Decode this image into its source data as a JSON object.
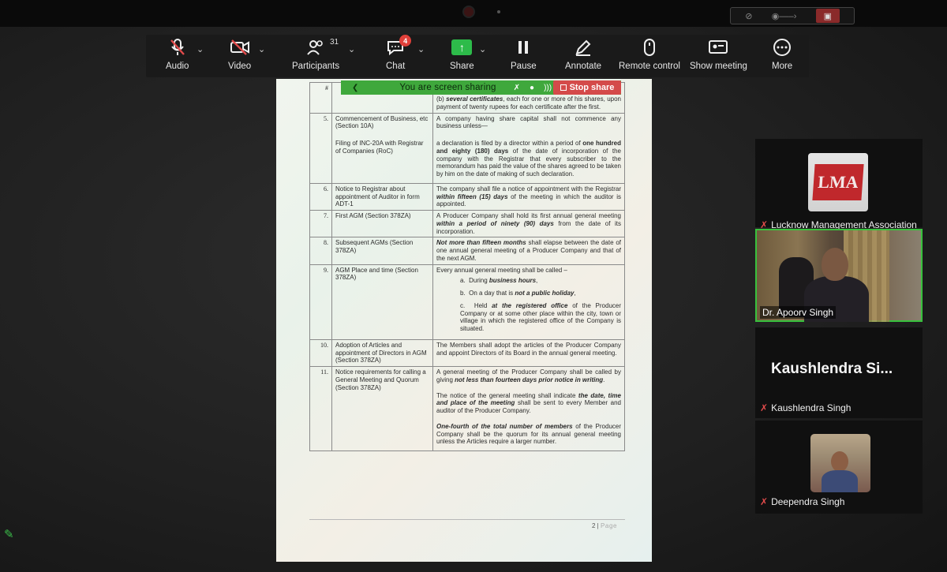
{
  "toolbar": {
    "audio": "Audio",
    "video": "Video",
    "participants": "Participants",
    "participants_count": "31",
    "chat": "Chat",
    "chat_badge": "4",
    "share": "Share",
    "pause": "Pause",
    "annotate": "Annotate",
    "remote_control": "Remote control",
    "show_meeting": "Show meeting",
    "more": "More"
  },
  "sharing_banner": {
    "text": "You are screen sharing",
    "stop_label": "Stop share"
  },
  "document": {
    "header_mark": "#",
    "row0_rule": "several certificates",
    "row0_text_a": "(b) ",
    "row0_text_b": ", each for one or more of his shares, upon payment of twenty rupees for each certificate after the first.",
    "rows": [
      {
        "num": "5.",
        "topic": "Commencement of Business, etc (Section 10A)",
        "topic2": "Filing of INC-20A with Registrar of Companies (RoC)",
        "rule1": "A company having share capital shall not commence any business unless—",
        "rule2a": "a declaration is filed by a director within a period of ",
        "rule2b": "one hundred and eighty (180) days",
        "rule2c": " of the date of incorporation of the company with the Registrar that every subscriber to the memorandum has paid the value of the shares agreed to be taken by him on the date of making of such declaration."
      },
      {
        "num": "6.",
        "topic": "Notice to Registrar about appointment of Auditor in form ADT-1",
        "rule_a": "The company shall file a notice of appointment with the Registrar ",
        "rule_b": "within fifteen (15) days",
        "rule_c": " of the meeting in which the auditor is appointed."
      },
      {
        "num": "7.",
        "topic": "First AGM (Section 378ZA)",
        "rule_a": "A Producer Company shall hold its first annual general meeting ",
        "rule_b": "within a period of ninety (90) days",
        "rule_c": " from the date of its incorporation."
      },
      {
        "num": "8.",
        "topic": "Subsequent AGMs (Section 378ZA)",
        "rule_b": "Not more than fifteen months",
        "rule_c": " shall elapse between the date of one annual general meeting of a Producer Company and that of the next AGM."
      },
      {
        "num": "9.",
        "topic": "AGM Place and time (Section 378ZA)",
        "rule_intro": "Every annual general meeting shall be called –",
        "items": [
          {
            "mark": "a.",
            "pre": "During ",
            "bold": "business hours",
            "post": ","
          },
          {
            "mark": "b.",
            "pre": "On a day that is ",
            "bold": "not a public holiday",
            "post": ","
          },
          {
            "mark": "c.",
            "pre": "Held ",
            "bold": "at the registered office",
            "post": " of the Producer Company or at some other place within the city, town or village in which the registered office of the Company is situated."
          }
        ]
      },
      {
        "num": "10.",
        "topic": "Adoption of Articles and appointment of Directors in AGM (Section 378ZA)",
        "rule": "The Members shall adopt the articles of the Producer Company and appoint Directors of its Board in the annual general meeting."
      },
      {
        "num": "11.",
        "topic": "Notice requirements for calling a General Meeting and Quorum (Section 378ZA)",
        "p1a": "A general meeting of the Producer Company shall be called by giving ",
        "p1b": "not less than fourteen days prior notice in writing",
        "p1c": ".",
        "p2a": "The notice of the general meeting shall indicate ",
        "p2b": "the date, time and place of the meeting",
        "p2c": " shall be sent to every Member and auditor of the Producer Company.",
        "p3b": "One-fourth of the total number of members",
        "p3c": " of the Producer Company shall be the quorum for its annual general meeting unless the Articles require a larger number."
      }
    ],
    "page_num": "2 | ",
    "page_word": "Page"
  },
  "participants": {
    "org_logo_text": "LMA",
    "org_name": "Lucknow Management Association",
    "speaker_name": "Dr. Apoorv Singh",
    "p3_big": "Kaushlendra Si...",
    "p3_name": "Kaushlendra Singh",
    "p4_name": "Deependra Singh"
  },
  "colors": {
    "share_green": "#3fa83c",
    "stop_red": "#d44a4a",
    "speaker_border": "#38c13d",
    "mute_red": "#e24b4b"
  }
}
